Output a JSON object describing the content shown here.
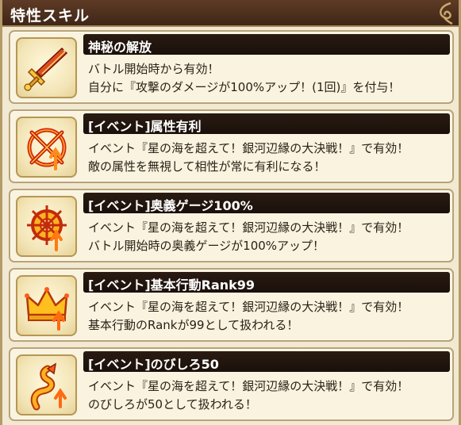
{
  "header": {
    "title": "特性スキル"
  },
  "skills": [
    {
      "name": "神秘の解放",
      "icon": "sword-icon",
      "desc1": "バトル開始時から有効！",
      "desc2": "自分に『攻撃のダメージが100%アップ！(1回)』を付与！"
    },
    {
      "name": "[イベント]属性有利",
      "icon": "attribute-advantage-icon",
      "desc1": "イベント『星の海を超えて！銀河辺縁の大決戦！』で有効！",
      "desc2": "敵の属性を無視して相性が常に有利になる！"
    },
    {
      "name": "[イベント]奥義ゲージ100%",
      "icon": "charge-gauge-icon",
      "desc1": "イベント『星の海を超えて！銀河辺縁の大決戦！』で有効！",
      "desc2": "バトル開始時の奥義ゲージが100%アップ！"
    },
    {
      "name": "[イベント]基本行動Rank99",
      "icon": "crown-icon",
      "desc1": "イベント『星の海を超えて！銀河辺縁の大決戦！』で有効！",
      "desc2": "基本行動のRankが99として扱われる！"
    },
    {
      "name": "[イベント]のびしろ50",
      "icon": "spiral-growth-icon",
      "desc1": "イベント『星の海を超えて！銀河辺縁の大決戦！』で有効！",
      "desc2": "のびしろが50として扱われる！"
    }
  ]
}
